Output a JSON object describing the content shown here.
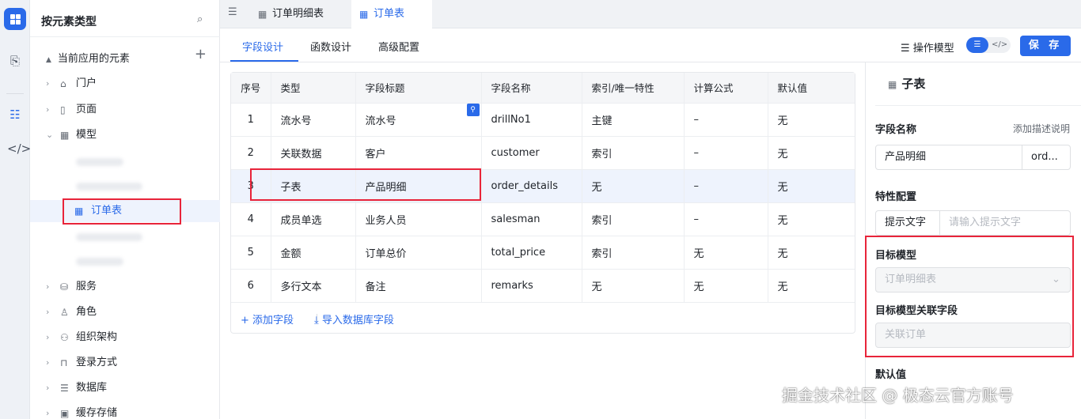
{
  "sidebar": {
    "title": "按元素类型",
    "group": "当前应用的元素",
    "items": [
      {
        "label": "门户",
        "icon": "home-icon"
      },
      {
        "label": "页面",
        "icon": "page-icon"
      },
      {
        "label": "模型",
        "icon": "table-icon"
      },
      {
        "label": "订单表",
        "icon": "table-icon"
      },
      {
        "label": "服务",
        "icon": "service-icon"
      },
      {
        "label": "角色",
        "icon": "role-icon"
      },
      {
        "label": "组织架构",
        "icon": "org-icon"
      },
      {
        "label": "登录方式",
        "icon": "login-icon"
      },
      {
        "label": "数据库",
        "icon": "database-icon"
      },
      {
        "label": "缓存存储",
        "icon": "cache-icon"
      }
    ]
  },
  "tabs": [
    {
      "label": "订单明细表"
    },
    {
      "label": "订单表"
    }
  ],
  "subtabs": [
    "字段设计",
    "函数设计",
    "高级配置"
  ],
  "toolbar": {
    "op_model": "操作模型",
    "save": "保 存"
  },
  "table": {
    "columns": [
      "序号",
      "类型",
      "字段标题",
      "字段名称",
      "索引/唯一特性",
      "计算公式",
      "默认值"
    ],
    "rows": [
      [
        "1",
        "流水号",
        "流水号",
        "drillNo1",
        "主键",
        "–",
        "无"
      ],
      [
        "2",
        "关联数据",
        "客户",
        "customer",
        "索引",
        "–",
        "无"
      ],
      [
        "3",
        "子表",
        "产品明细",
        "order_details",
        "无",
        "–",
        "无"
      ],
      [
        "4",
        "成员单选",
        "业务人员",
        "salesman",
        "索引",
        "–",
        "无"
      ],
      [
        "5",
        "金额",
        "订单总价",
        "total_price",
        "索引",
        "无",
        "无"
      ],
      [
        "6",
        "多行文本",
        "备注",
        "remarks",
        "无",
        "无",
        "无"
      ]
    ],
    "add_field": "+ 添加字段",
    "import_field": "导入数据库字段"
  },
  "panel": {
    "title": "子表",
    "field_name_label": "字段名称",
    "add_desc": "添加描述说明",
    "field_name_value": "产品明细",
    "field_key_value": "ord...",
    "feature_label": "特性配置",
    "hint_label": "提示文字",
    "hint_placeholder": "请输入提示文字",
    "target_model_label": "目标模型",
    "target_model_value": "订单明细表",
    "target_field_label": "目标模型关联字段",
    "target_field_value": "关联订单",
    "default_label": "默认值"
  },
  "watermark": "掘金技术社区 @ 极态云官方账号"
}
